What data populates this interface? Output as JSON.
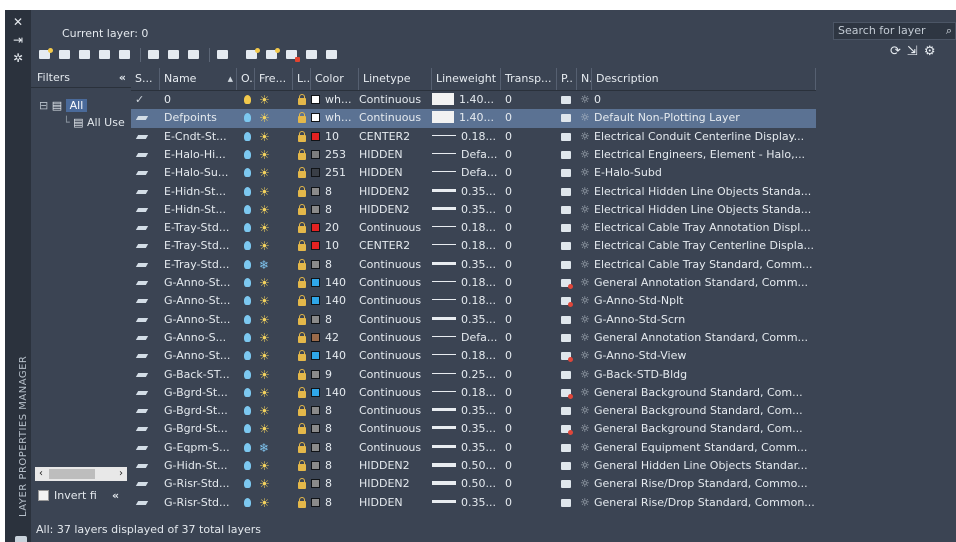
{
  "palette": {
    "title_vertical": "LAYER PROPERTIES MANAGER"
  },
  "header": {
    "current_layer": "Current layer: 0",
    "search_placeholder": "Search for layer"
  },
  "filters": {
    "title": "Filters",
    "collapse": "«",
    "tree_all": "All",
    "tree_used": "All Use",
    "invert_label": "Invert fi",
    "invert_collapse": "«"
  },
  "columns": [
    "S...",
    "Name",
    "O..",
    "Fre...",
    "L...",
    "Color",
    "Linetype",
    "Lineweight",
    "Transp...",
    "P..",
    "N..",
    "Description"
  ],
  "layers": [
    {
      "status": "current",
      "name": "0",
      "freeze": "sun",
      "color_hex": "#ffffff",
      "color": "wh...",
      "linetype": "Continuous",
      "lw_style": "box",
      "lineweight": "1.40...",
      "transp": "0",
      "plot": "print",
      "desc": "0"
    },
    {
      "status": "layer",
      "name": "Defpoints",
      "freeze": "sun",
      "color_hex": "#ffffff",
      "color": "wh...",
      "linetype": "Continuous",
      "lw_style": "box",
      "lineweight": "1.40...",
      "transp": "0",
      "plot": "print",
      "desc": "Default Non-Plotting Layer",
      "selected": true
    },
    {
      "status": "layer",
      "name": "E-Cndt-St...",
      "freeze": "sun",
      "color_hex": "#e32222",
      "color": "10",
      "linetype": "CENTER2",
      "lw_style": "thin",
      "lineweight": "0.18...",
      "transp": "0",
      "plot": "print",
      "desc": "Electrical Conduit Centerline Display..."
    },
    {
      "status": "layer",
      "name": "E-Halo-Hi...",
      "freeze": "sun",
      "color_hex": "#7d7d7d",
      "color": "253",
      "linetype": "HIDDEN",
      "lw_style": "thin",
      "lineweight": "Defa...",
      "transp": "0",
      "plot": "print",
      "desc": "Electrical Engineers, Element - Halo,..."
    },
    {
      "status": "layer",
      "name": "E-Halo-Su...",
      "freeze": "sun",
      "color_hex": "#3a3f47",
      "color": "251",
      "linetype": "HIDDEN",
      "lw_style": "thin",
      "lineweight": "Defa...",
      "transp": "0",
      "plot": "print",
      "desc": "E-Halo-Subd"
    },
    {
      "status": "layer",
      "name": "E-Hidn-St...",
      "freeze": "sun",
      "color_hex": "#8a8a8a",
      "color": "8",
      "linetype": "HIDDEN2",
      "lw_style": "mid",
      "lineweight": "0.35...",
      "transp": "0",
      "plot": "print",
      "desc": "Electrical Hidden Line Objects Standa..."
    },
    {
      "status": "layer",
      "name": "E-Hidn-St...",
      "freeze": "sun",
      "color_hex": "#8a8a8a",
      "color": "8",
      "linetype": "HIDDEN2",
      "lw_style": "mid",
      "lineweight": "0.35...",
      "transp": "0",
      "plot": "print",
      "desc": "Electrical Hidden Line Objects Standa..."
    },
    {
      "status": "layer",
      "name": "E-Tray-Std...",
      "freeze": "sun",
      "color_hex": "#e32222",
      "color": "20",
      "linetype": "Continuous",
      "lw_style": "thin",
      "lineweight": "0.18...",
      "transp": "0",
      "plot": "print",
      "desc": "Electrical Cable Tray Annotation Displ..."
    },
    {
      "status": "layer",
      "name": "E-Tray-Std...",
      "freeze": "sun",
      "color_hex": "#e32222",
      "color": "10",
      "linetype": "CENTER2",
      "lw_style": "thin",
      "lineweight": "0.18...",
      "transp": "0",
      "plot": "print",
      "desc": "Electrical Cable Tray Centerline Displa..."
    },
    {
      "status": "layer",
      "name": "E-Tray-Std...",
      "freeze": "snow",
      "color_hex": "#8a8a8a",
      "color": "8",
      "linetype": "Continuous",
      "lw_style": "mid",
      "lineweight": "0.35...",
      "transp": "0",
      "plot": "print",
      "desc": "Electrical Cable Tray Standard, Comm..."
    },
    {
      "status": "layer",
      "name": "G-Anno-St...",
      "freeze": "sun",
      "color_hex": "#2fa6e8",
      "color": "140",
      "linetype": "Continuous",
      "lw_style": "thin",
      "lineweight": "0.18...",
      "transp": "0",
      "plot": "noplot",
      "desc": "General Annotation Standard, Comm..."
    },
    {
      "status": "layer",
      "name": "G-Anno-St...",
      "freeze": "sun",
      "color_hex": "#2fa6e8",
      "color": "140",
      "linetype": "Continuous",
      "lw_style": "thin",
      "lineweight": "0.18...",
      "transp": "0",
      "plot": "noplot",
      "desc": "G-Anno-Std-Nplt"
    },
    {
      "status": "layer",
      "name": "G-Anno-St...",
      "freeze": "sun",
      "color_hex": "#8a8a8a",
      "color": "8",
      "linetype": "Continuous",
      "lw_style": "mid",
      "lineweight": "0.35...",
      "transp": "0",
      "plot": "print",
      "desc": "G-Anno-Std-Scrn"
    },
    {
      "status": "layer",
      "name": "G-Anno-S...",
      "freeze": "sun",
      "color_hex": "#9a6a4a",
      "color": "42",
      "linetype": "Continuous",
      "lw_style": "thin",
      "lineweight": "Defa...",
      "transp": "0",
      "plot": "print",
      "desc": "General Annotation Standard, Comm..."
    },
    {
      "status": "layer",
      "name": "G-Anno-St...",
      "freeze": "sun",
      "color_hex": "#2fa6e8",
      "color": "140",
      "linetype": "Continuous",
      "lw_style": "thin",
      "lineweight": "0.18...",
      "transp": "0",
      "plot": "noplot",
      "desc": "G-Anno-Std-View"
    },
    {
      "status": "layer",
      "name": "G-Back-ST...",
      "freeze": "sun",
      "color_hex": "#8a8a8a",
      "color": "9",
      "linetype": "Continuous",
      "lw_style": "thin",
      "lineweight": "0.25...",
      "transp": "0",
      "plot": "print",
      "desc": "G-Back-STD-Bldg"
    },
    {
      "status": "layer",
      "name": "G-Bgrd-St...",
      "freeze": "sun",
      "color_hex": "#2fa6e8",
      "color": "140",
      "linetype": "Continuous",
      "lw_style": "thin",
      "lineweight": "0.18...",
      "transp": "0",
      "plot": "noplot",
      "desc": "General Background Standard, Com..."
    },
    {
      "status": "layer",
      "name": "G-Bgrd-St...",
      "freeze": "sun",
      "color_hex": "#8a8a8a",
      "color": "8",
      "linetype": "Continuous",
      "lw_style": "mid",
      "lineweight": "0.35...",
      "transp": "0",
      "plot": "print",
      "desc": "General Background Standard, Com..."
    },
    {
      "status": "layer",
      "name": "G-Bgrd-St...",
      "freeze": "sun",
      "color_hex": "#8a8a8a",
      "color": "8",
      "linetype": "Continuous",
      "lw_style": "mid",
      "lineweight": "0.35...",
      "transp": "0",
      "plot": "noplot",
      "desc": "General Background Standard, Com..."
    },
    {
      "status": "layer",
      "name": "G-Eqpm-S...",
      "freeze": "snow",
      "color_hex": "#8a8a8a",
      "color": "8",
      "linetype": "Continuous",
      "lw_style": "mid",
      "lineweight": "0.35...",
      "transp": "0",
      "plot": "print",
      "desc": "General Equipment Standard, Comm..."
    },
    {
      "status": "layer",
      "name": "G-Hidn-St...",
      "freeze": "sun",
      "color_hex": "#8a8a8a",
      "color": "8",
      "linetype": "HIDDEN2",
      "lw_style": "thick",
      "lineweight": "0.50...",
      "transp": "0",
      "plot": "print",
      "desc": "General Hidden Line Objects Standar..."
    },
    {
      "status": "layer",
      "name": "G-Risr-Std...",
      "freeze": "sun",
      "color_hex": "#8a8a8a",
      "color": "8",
      "linetype": "HIDDEN2",
      "lw_style": "thick",
      "lineweight": "0.50...",
      "transp": "0",
      "plot": "print",
      "desc": "General Rise/Drop Standard, Commo..."
    },
    {
      "status": "layer",
      "name": "G-Risr-Std...",
      "freeze": "sun",
      "color_hex": "#8a8a8a",
      "color": "8",
      "linetype": "HIDDEN",
      "lw_style": "mid",
      "lineweight": "0.35...",
      "transp": "0",
      "plot": "print",
      "desc": "General Rise/Drop Standard, Common..."
    }
  ],
  "status_bar": "All: 37 layers displayed of 37 total layers"
}
